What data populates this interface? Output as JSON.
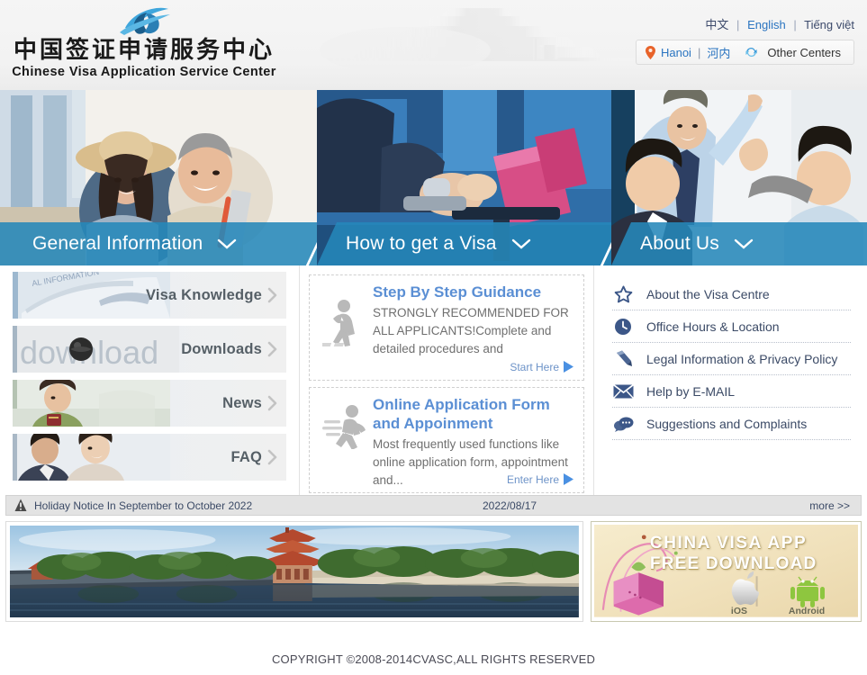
{
  "header": {
    "brand_cn": "中国签证申请服务中心",
    "brand_en": "Chinese Visa Application Service Center",
    "logo_icon": "swoosh-globe-logo",
    "watermark_icon": "pagoda-watermark",
    "languages": [
      {
        "label": "中文",
        "active": false
      },
      {
        "label": "English",
        "active": true
      },
      {
        "label": "Tiếng việt",
        "active": false
      }
    ],
    "separator": "|",
    "center_selector": {
      "pin_icon": "location-pin-icon",
      "city_en": "Hanoi",
      "city_pipe": "|",
      "city_cn": "河内",
      "refresh_icon": "refresh-icon",
      "other_label": "Other Centers"
    }
  },
  "hero": {
    "chevron_icon": "chevron-down-icon",
    "panels": [
      {
        "label": "General Information",
        "image": "couple-travelers-photo"
      },
      {
        "label": "How to get a Visa",
        "image": "passport-handover-photo"
      },
      {
        "label": "About Us",
        "image": "businessmen-celebrating-photo"
      }
    ]
  },
  "left_menu": {
    "arrow_icon": "chevron-right-icon",
    "items": [
      {
        "label": "Visa Knowledge",
        "image": "airplane-information-photo"
      },
      {
        "label": "Downloads",
        "image": "download-word-photo"
      },
      {
        "label": "News",
        "image": "girl-with-passport-photo"
      },
      {
        "label": "FAQ",
        "image": "consultation-desk-photo"
      }
    ]
  },
  "mid_cards": [
    {
      "icon": "walking-person-icon",
      "title": "Step By Step Guidance",
      "desc": "STRONGLY RECOMMENDED FOR ALL APPLICANTS!Complete and detailed procedures and",
      "cta_label": "Start Here",
      "cta_icon": "play-triangle-icon"
    },
    {
      "icon": "running-person-icon",
      "title": "Online Application Form and Appoinment",
      "desc": "Most frequently used functions like online application form, appointment and...",
      "cta_label": "Enter Here",
      "cta_icon": "play-triangle-icon"
    }
  ],
  "right_links": [
    {
      "icon": "star-icon",
      "label": "About the Visa Centre"
    },
    {
      "icon": "clock-icon",
      "label": "Office Hours & Location"
    },
    {
      "icon": "pencil-icon",
      "label": "Legal Information & Privacy Policy"
    },
    {
      "icon": "envelope-icon",
      "label": "Help by E-MAIL"
    },
    {
      "icon": "speech-bubble-icon",
      "label": "Suggestions and Complaints"
    }
  ],
  "notice": {
    "icon": "warning-triangle-icon",
    "title": "Holiday Notice In September to October 2022",
    "date": "2022/08/17",
    "more_label": "more >>"
  },
  "banners": {
    "left": {
      "image": "forbidden-city-moat-photo"
    },
    "right": {
      "title_line1": "CHINA VISA  APP",
      "title_line2": "FREE DOWNLOAD",
      "gift_icon": "pink-gift-box-icon",
      "ios_icon": "apple-icon",
      "ios_label": "iOS",
      "android_icon": "android-icon",
      "android_label": "Android"
    }
  },
  "footer": {
    "copyright": "COPYRIGHT ©2008-2014CVASC,ALL RIGHTS RESERVED"
  },
  "colors": {
    "hero_blue": "#2687ba",
    "link_blue": "#2a74c0",
    "card_title_blue": "#5b8fd4",
    "navy": "#3b4a66",
    "notice_bg": "#e3e3e3"
  }
}
